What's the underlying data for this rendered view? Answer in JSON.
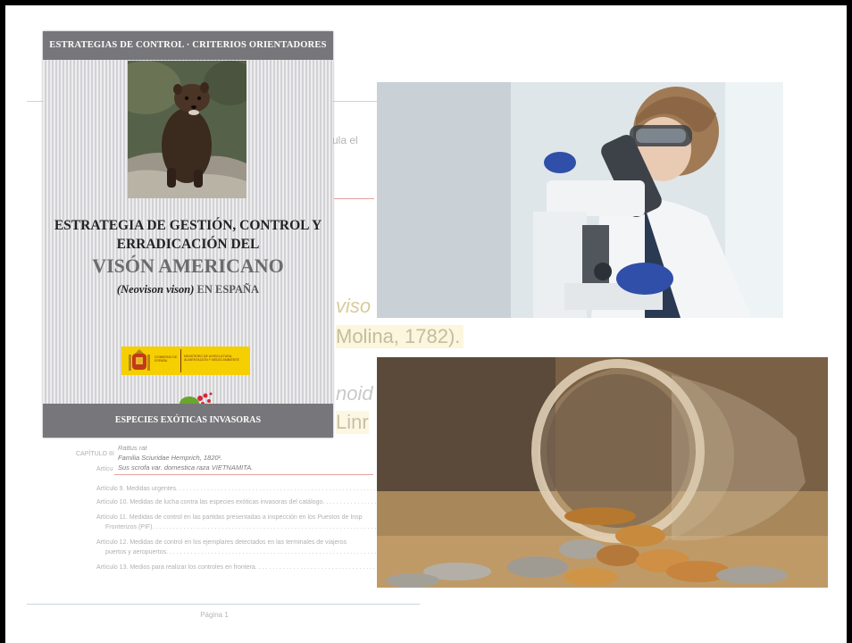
{
  "book_cover": {
    "top_band": "ESTRATEGIAS DE CONTROL · CRITERIOS ORIENTADORES",
    "title_line1": "ESTRATEGIA DE GESTIÓN, CONTROL Y",
    "title_line2": "ERRADICACIÓN DEL",
    "title_line3": "VISÓN AMERICANO",
    "subtitle_latin": "(Neovison vison)",
    "subtitle_rest": " EN ESPAÑA",
    "gov_logo_left": "GOBIERNO DE ESPAÑA",
    "gov_logo_right": "MINISTERIO DE AGRICULTURA, ALIMENTACIÓN Y MEDIO AMBIENTE",
    "bottom_band": "ESPECIES EXÓTICAS INVASORAS"
  },
  "background_document": {
    "fragment_ula": "ula el",
    "fragment_viso": "viso",
    "fragment_molina": "Molina, 1782).",
    "fragment_noid": "noid",
    "fragment_linr": "Linr",
    "capitulo": "CAPÍTULO III",
    "rattus": "Rattus rat",
    "familia": "Familia Sciuridae Hemprich, 1820¹.",
    "sus": "Sus scrofa var. domestica raza VIETNAMITA.",
    "articulo_short": "Artícu",
    "articulo_9": "Artículo 9. Medidas urgentes. . . . . . . . . . . . . . . . . . . . . . . . . . . . . . . . . . . . . . . . . . . . . . . . . . . . . . . . . . . . . .",
    "articulo_10": "Artículo 10. Medidas de lucha contra las especies exóticas invasoras del catálogo. . . . . . . . . . . . . . . . . . . . . . . . .",
    "articulo_11": "Artículo 11. Medidas de control en las partidas presentadas a inspección en los Puestos de Insp",
    "articulo_11b": "Fronterizos (PIF). . . . . . . . . . . . . . . . . . . . . . . . . . . . . . . . . . . . . . . . . . . . . . . . . . . . . . . . . . . . . . . . .",
    "articulo_12": "Artículo 12. Medidas de control en los ejemplares detectados en las terminales de viajeros",
    "articulo_12b": "puertos y aeropuertos. . . . . . . . . . . . . . . . . . . . . . . . . . . . . . . . . . . . . . . . . . . . . . . . . . . . . . . . . . . . . .",
    "articulo_13": "Artículo 13. Medios para realizar los controles en frontera. . . . . . . . . . . . . . . . . . . . . . . . . . . . . . . . . . . . . . .",
    "footer": "Página 1"
  }
}
